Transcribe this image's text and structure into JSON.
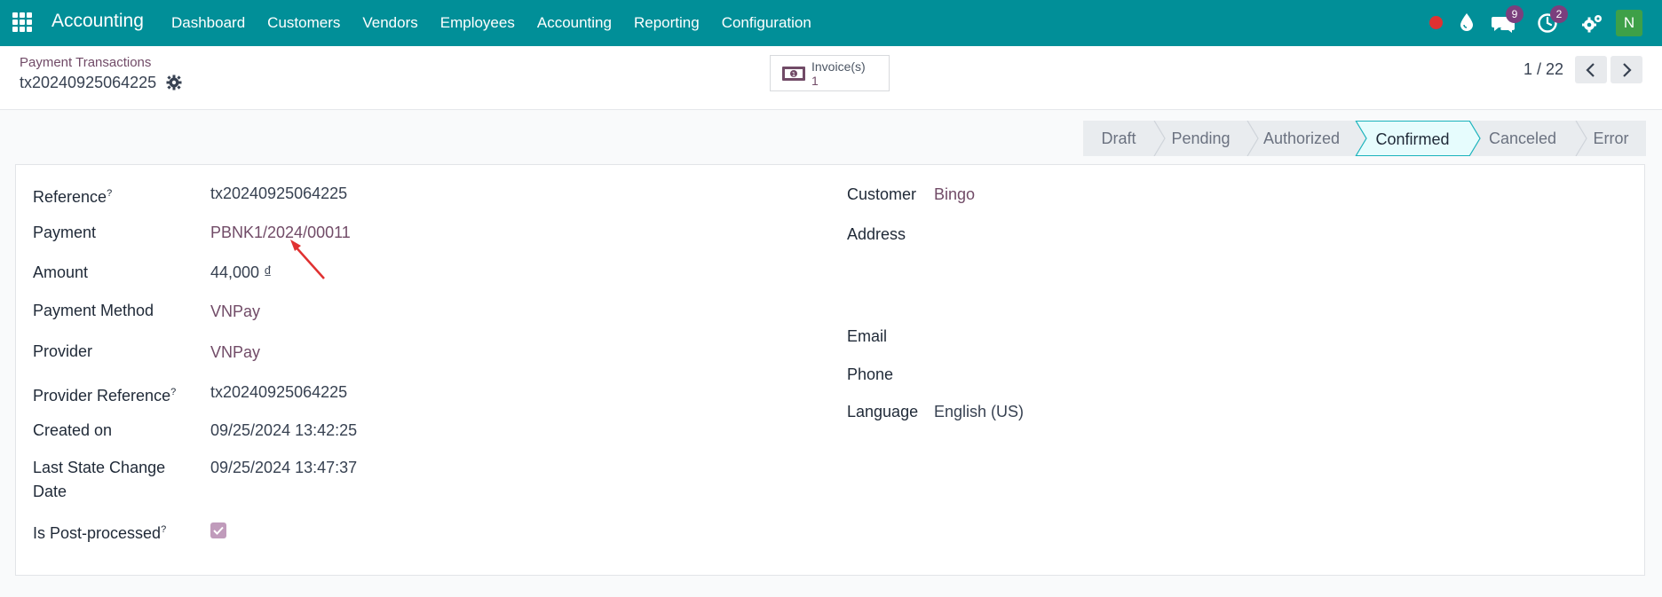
{
  "navbar": {
    "app_name": "Accounting",
    "menu": [
      "Dashboard",
      "Customers",
      "Vendors",
      "Employees",
      "Accounting",
      "Reporting",
      "Configuration"
    ],
    "chat_badge": "9",
    "activity_badge": "2",
    "avatar_letter": "N"
  },
  "control": {
    "breadcrumb": "Payment Transactions",
    "record_title": "tx20240925064225",
    "smart_button": {
      "label": "Invoice(s)",
      "value": "1"
    },
    "pager": "1 / 22"
  },
  "statusbar": {
    "stages": [
      "Draft",
      "Pending",
      "Authorized",
      "Confirmed",
      "Canceled",
      "Error"
    ],
    "active": "Confirmed"
  },
  "form": {
    "left": {
      "reference_label": "Reference",
      "reference_value": "tx20240925064225",
      "payment_label": "Payment",
      "payment_value": "PBNK1/2024/00011",
      "amount_label": "Amount",
      "amount_value": "44,000 ₫",
      "payment_method_label": "Payment Method",
      "payment_method_value": "VNPay",
      "provider_label": "Provider",
      "provider_value": "VNPay",
      "provider_reference_label": "Provider Reference",
      "provider_reference_value": "tx20240925064225",
      "created_on_label": "Created on",
      "created_on_value": "09/25/2024 13:42:25",
      "last_state_label_line1": "Last State Change",
      "last_state_label_line2": "Date",
      "last_state_value": "09/25/2024 13:47:37",
      "post_processed_label": "Is Post-processed",
      "post_processed_checked": true,
      "help_mark": "?"
    },
    "right": {
      "customer_label": "Customer",
      "customer_value": "Bingo",
      "address_label": "Address",
      "email_label": "Email",
      "phone_label": "Phone",
      "language_label": "Language",
      "language_value": "English (US)"
    }
  },
  "colors": {
    "navbar": "#018f98",
    "link": "#714b67",
    "badge": "#7b3f7d",
    "active_stage": "#e6fcfd"
  }
}
